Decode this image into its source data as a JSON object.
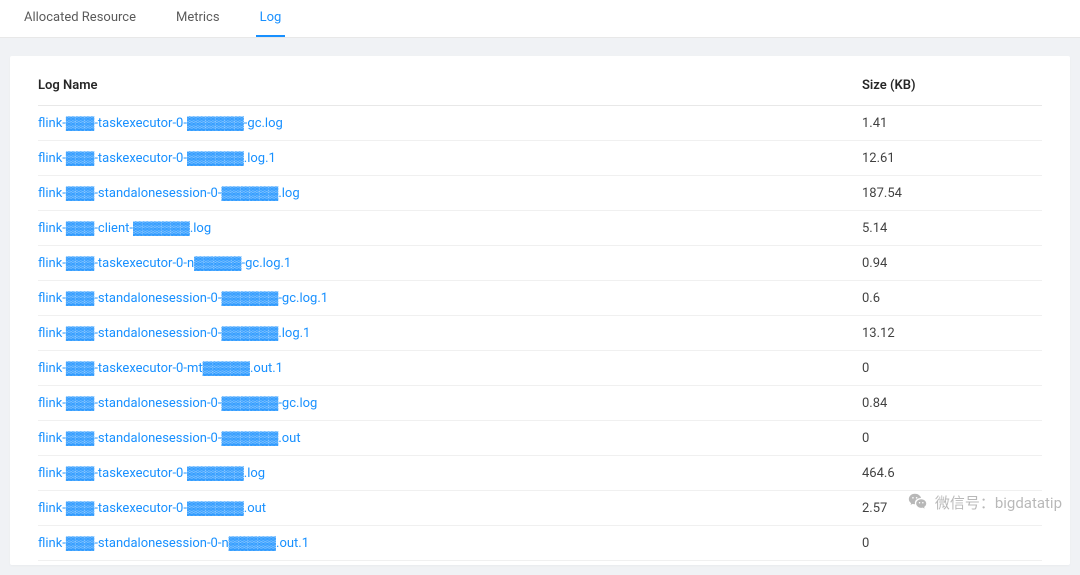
{
  "tabs": [
    {
      "label": "Allocated Resource",
      "active": false
    },
    {
      "label": "Metrics",
      "active": false
    },
    {
      "label": "Log",
      "active": true
    }
  ],
  "table": {
    "col_name": "Log Name",
    "col_size": "Size (KB)",
    "rows": [
      {
        "name": "flink-▓▓▓-taskexecutor-0-▓▓▓▓▓▓-gc.log",
        "size": "1.41"
      },
      {
        "name": "flink-▓▓▓-taskexecutor-0-▓▓▓▓▓▓.log.1",
        "size": "12.61"
      },
      {
        "name": "flink-▓▓▓-standalonesession-0-▓▓▓▓▓▓.log",
        "size": "187.54"
      },
      {
        "name": "flink-▓▓▓-client-▓▓▓▓▓▓.log",
        "size": "5.14"
      },
      {
        "name": "flink-▓▓▓-taskexecutor-0-n▓▓▓▓▓-gc.log.1",
        "size": "0.94"
      },
      {
        "name": "flink-▓▓▓-standalonesession-0-▓▓▓▓▓▓-gc.log.1",
        "size": "0.6"
      },
      {
        "name": "flink-▓▓▓-standalonesession-0-▓▓▓▓▓▓.log.1",
        "size": "13.12"
      },
      {
        "name": "flink-▓▓▓-taskexecutor-0-mt▓▓▓▓▓.out.1",
        "size": "0"
      },
      {
        "name": "flink-▓▓▓-standalonesession-0-▓▓▓▓▓▓-gc.log",
        "size": "0.84"
      },
      {
        "name": "flink-▓▓▓-standalonesession-0-▓▓▓▓▓▓.out",
        "size": "0"
      },
      {
        "name": "flink-▓▓▓-taskexecutor-0-▓▓▓▓▓▓.log",
        "size": "464.6"
      },
      {
        "name": "flink-▓▓▓-taskexecutor-0-▓▓▓▓▓▓.out",
        "size": "2.57"
      },
      {
        "name": "flink-▓▓▓-standalonesession-0-n▓▓▓▓▓.out.1",
        "size": "0"
      }
    ]
  },
  "watermark": {
    "label": "微信号：bigdatatip"
  }
}
